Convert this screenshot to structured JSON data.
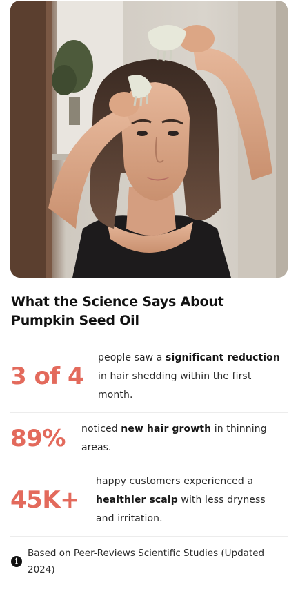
{
  "hero": {
    "image": "woman-applying-pumpkin-seed-oil-with-scalp-massager"
  },
  "headline": {
    "line1": "What the Science Says About",
    "line2": "Pumpkin Seed Oil"
  },
  "stats": [
    {
      "value": "3 of 4",
      "text_before": "people saw a ",
      "bold1": "significant reduction",
      "text_after": " in hair shedding within the first month."
    },
    {
      "value": "89%",
      "text_before": "noticed ",
      "bold1": "new hair growth",
      "text_after": " in thinning areas."
    },
    {
      "value": "45K+",
      "text_before": "happy customers experienced a ",
      "bold1": "healthier scalp",
      "text_after": " with less dryness and irritation."
    }
  ],
  "footnote": {
    "icon": "info-icon",
    "text": "Based on Peer-Reviews Scientific Studies (Updated 2024)"
  },
  "colors": {
    "accent": "#e36a5c",
    "text": "#1f1f1f",
    "divider": "#ececec"
  }
}
